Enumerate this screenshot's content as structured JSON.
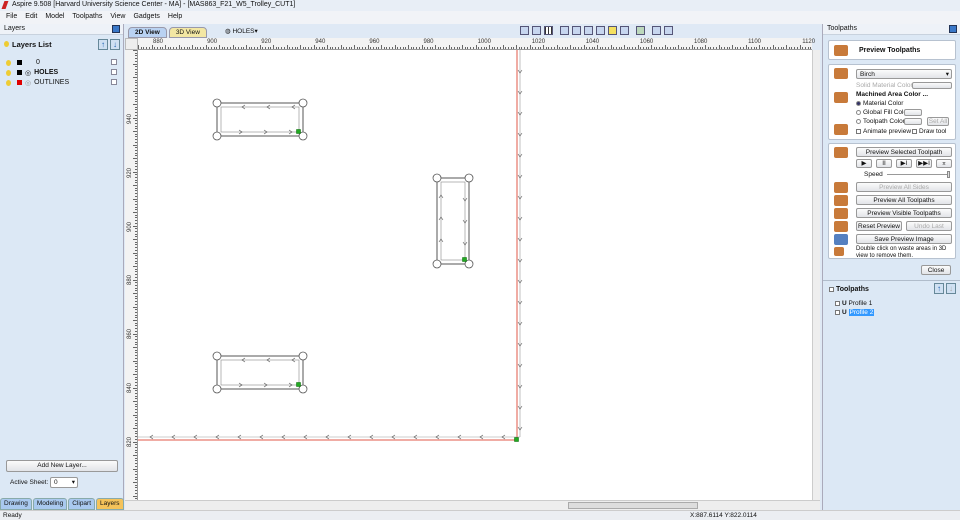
{
  "window": {
    "title": "Aspire 9.508 [Harvard University Science Center - MA] - [MAS863_F21_W5_Trolley_CUT1]"
  },
  "menu": [
    "File",
    "Edit",
    "Model",
    "Toolpaths",
    "View",
    "Gadgets",
    "Help"
  ],
  "left_panel": {
    "header": "Layers",
    "list_title": "Layers List",
    "layers": [
      {
        "name": "0",
        "color": "#000000"
      },
      {
        "name": "HOLES",
        "color": "#000000"
      },
      {
        "name": "OUTLINES",
        "color": "#dd0000"
      }
    ],
    "add_button": "Add New Layer...",
    "active_sheet_label": "Active Sheet:",
    "active_sheet_value": "0",
    "tabs": [
      "Drawing",
      "Modeling",
      "Clipart",
      "Layers"
    ],
    "active_tab": "Layers"
  },
  "view_tabs": [
    "2D View",
    "3D View"
  ],
  "layer_dropdown": "HOLES",
  "rulers": {
    "x_ticks": [
      "880",
      "900",
      "920",
      "940",
      "960",
      "980",
      "1000",
      "1020",
      "1040",
      "1060",
      "1080",
      "1100",
      "1120"
    ],
    "y_ticks": [
      "940",
      "920",
      "900",
      "880",
      "860",
      "840",
      "820"
    ]
  },
  "right_panel": {
    "header": "Toolpaths",
    "title": "Preview Toolpaths",
    "material": "Birch",
    "solid_material_color": "Solid Material Color",
    "machined_area_color": "Machined Area Color ...",
    "material_color": "Material Color",
    "global_fill_color": "Global Fill Color",
    "toolpath_color": "Toolpath Color",
    "set_all": "Set All",
    "animate_preview": "Animate preview",
    "draw_tool": "Draw tool",
    "preview_selected": "Preview Selected Toolpath",
    "speed": "Speed",
    "preview_all_sides": "Preview All Sides",
    "preview_all": "Preview All Toolpaths",
    "preview_visible": "Preview Visible Toolpaths",
    "reset_preview": "Reset Preview",
    "undo_last": "Undo Last",
    "save_preview": "Save Preview Image",
    "hint": "Double click on waste areas in 3D view to remove them.",
    "close": "Close",
    "toolpaths_title": "Toolpaths",
    "toolpaths": [
      "Profile 1",
      "Profile 2"
    ],
    "selected_toolpath": "Profile 2"
  },
  "status": {
    "left": "Ready",
    "coords": "X:887.6114 Y:822.0114"
  },
  "colors": {
    "outline": "#e05a4a",
    "accent": "#3a78c8",
    "selection": "#3399ff"
  }
}
